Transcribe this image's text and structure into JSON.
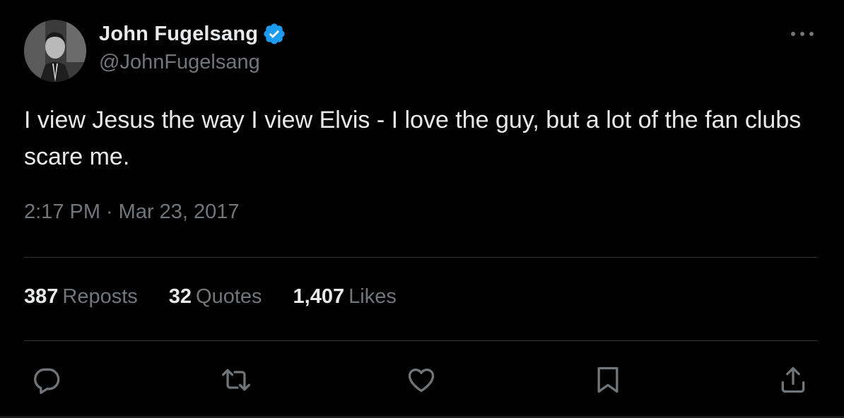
{
  "author": {
    "display_name": "John Fugelsang",
    "handle": "@JohnFugelsang",
    "verified_color": "#1d9bf0"
  },
  "tweet": {
    "text": "I view Jesus the way I view Elvis - I love the guy, but a lot of the fan clubs scare me.",
    "time": "2:17 PM",
    "separator": "·",
    "date": "Mar 23, 2017"
  },
  "stats": {
    "reposts_count": "387",
    "reposts_label": "Reposts",
    "quotes_count": "32",
    "quotes_label": "Quotes",
    "likes_count": "1,407",
    "likes_label": "Likes"
  },
  "icons": {
    "more": "more-dots-icon",
    "reply": "reply-icon",
    "repost": "repost-icon",
    "like": "heart-icon",
    "bookmark": "bookmark-icon",
    "share": "share-icon"
  },
  "colors": {
    "background": "#000000",
    "text_primary": "#e7e9ea",
    "text_secondary": "#71767b",
    "divider": "#2f3336",
    "accent": "#1d9bf0"
  }
}
